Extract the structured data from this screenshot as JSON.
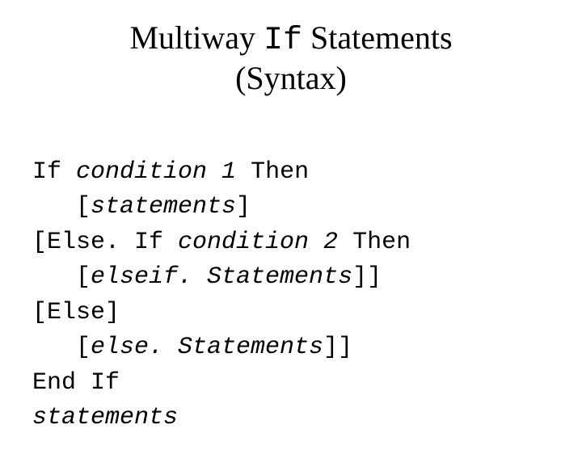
{
  "title": {
    "pre": "Multiway ",
    "code": "If",
    "post": " Statements",
    "line2": "(Syntax)"
  },
  "code": {
    "l1a": "If ",
    "l1b": "condition 1",
    "l1c": " Then",
    "l2a": "[",
    "l2b": "statements",
    "l2c": "]",
    "l3a": "[Else. If ",
    "l3b": "condition 2",
    "l3c": " Then",
    "l4a": "[",
    "l4b": "elseif. Statements",
    "l4c": "]]",
    "l5": "[Else]",
    "l6a": "[",
    "l6b": "else. Statements",
    "l6c": "]]",
    "l7": "End If",
    "l8": "statements"
  }
}
